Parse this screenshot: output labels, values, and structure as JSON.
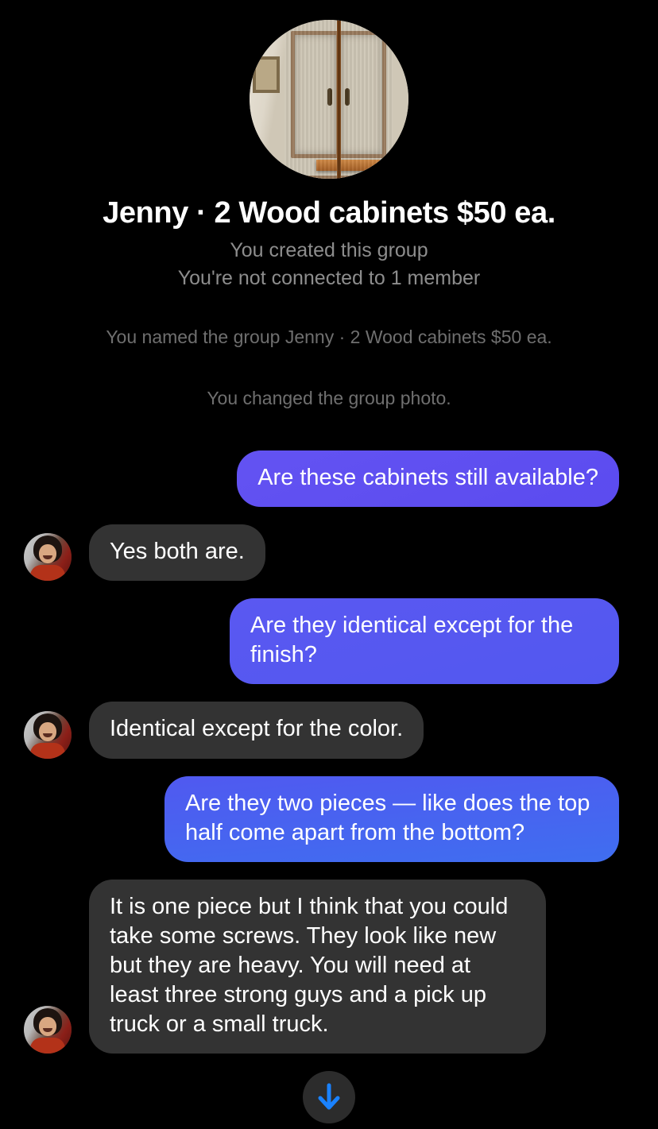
{
  "app": {
    "background_color": "#000000",
    "accent_sent_bubble": "#5c4ef0",
    "received_bubble": "#333333",
    "muted_text": "#8d8d8d",
    "system_text": "#6f6f6f"
  },
  "group_header": {
    "avatar_name": "group-photo-wood-cabinets",
    "title": "Jenny · 2 Wood cabinets $50 ea.",
    "subtitle_1": "You created this group",
    "subtitle_2": "You're not connected to 1 member"
  },
  "system_notices": [
    "You named the group Jenny · 2 Wood cabinets $50 ea.",
    "You changed the group photo."
  ],
  "messages": [
    {
      "id": "msg-1",
      "direction": "outgoing",
      "text": "Are these cabinets still available?",
      "has_avatar": false
    },
    {
      "id": "msg-2",
      "direction": "incoming",
      "text": "Yes both are.",
      "has_avatar": true,
      "avatar_name": "sender-avatar-jenny"
    },
    {
      "id": "msg-3",
      "direction": "outgoing",
      "text": "Are they identical except for the finish?",
      "has_avatar": false
    },
    {
      "id": "msg-4",
      "direction": "incoming",
      "text": "Identical except for the color.",
      "has_avatar": true,
      "avatar_name": "sender-avatar-jenny"
    },
    {
      "id": "msg-5",
      "direction": "outgoing",
      "text": "Are they two pieces — like does the top half come apart from the bottom?",
      "has_avatar": false
    },
    {
      "id": "msg-6",
      "direction": "incoming",
      "text": "It is one piece but I think that you could take some screws. They look like new but they are heavy. You will need at least three strong guys and a pick up truck or a small truck.",
      "has_avatar": true,
      "avatar_name": "sender-avatar-jenny"
    }
  ],
  "scroll_button": {
    "icon": "arrow-down-icon",
    "color": "#1a82ff",
    "label": "Scroll to latest message"
  }
}
